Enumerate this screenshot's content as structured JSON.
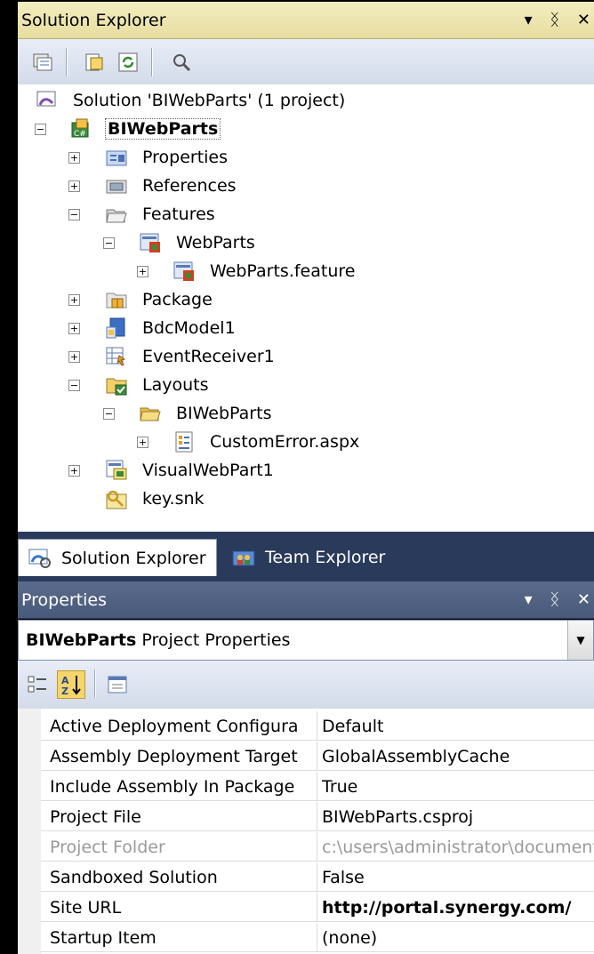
{
  "solution_explorer": {
    "title": "Solution Explorer",
    "header_controls": [
      "▾",
      "1̅",
      "✕"
    ],
    "toolbar": [
      {
        "name": "show-all-files-icon"
      },
      {
        "name": "properties-icon"
      },
      {
        "name": "refresh-icon"
      },
      {
        "name": "view-class-diagram-icon"
      }
    ],
    "tree": {
      "solution": "Solution 'BIWebParts' (1 project)",
      "project": "BIWebParts",
      "items": {
        "properties": "Properties",
        "references": "References",
        "features": "Features",
        "webparts": "WebParts",
        "webparts_feature": "WebParts.feature",
        "package": "Package",
        "bdcmodel": "BdcModel1",
        "eventreceiver": "EventReceiver1",
        "layouts": "Layouts",
        "layouts_biwebparts": "BIWebParts",
        "customerror": "CustomError.aspx",
        "visualwebpart": "VisualWebPart1",
        "keysnk": "key.snk"
      }
    }
  },
  "tabs": {
    "solution_explorer": "Solution Explorer",
    "team_explorer": "Team Explorer"
  },
  "properties": {
    "title": "Properties",
    "selector_object": "BIWebParts",
    "selector_type": "Project Properties",
    "rows": [
      {
        "name": "Active Deployment Configura",
        "value": "Default"
      },
      {
        "name": "Assembly Deployment Target",
        "value": "GlobalAssemblyCache"
      },
      {
        "name": "Include Assembly In Package",
        "value": "True"
      },
      {
        "name": "Project File",
        "value": "BIWebParts.csproj"
      },
      {
        "name": "Project Folder",
        "value": "c:\\users\\administrator\\documents"
      },
      {
        "name": "Sandboxed Solution",
        "value": "False"
      },
      {
        "name": "Site URL",
        "value": "http://portal.synergy.com/"
      },
      {
        "name": "Startup Item",
        "value": "(none)"
      }
    ]
  },
  "colors": {
    "header_yellow": "#e6dd9f",
    "header_blue": "#49597a",
    "tabstrip": "#2a3a5a"
  }
}
